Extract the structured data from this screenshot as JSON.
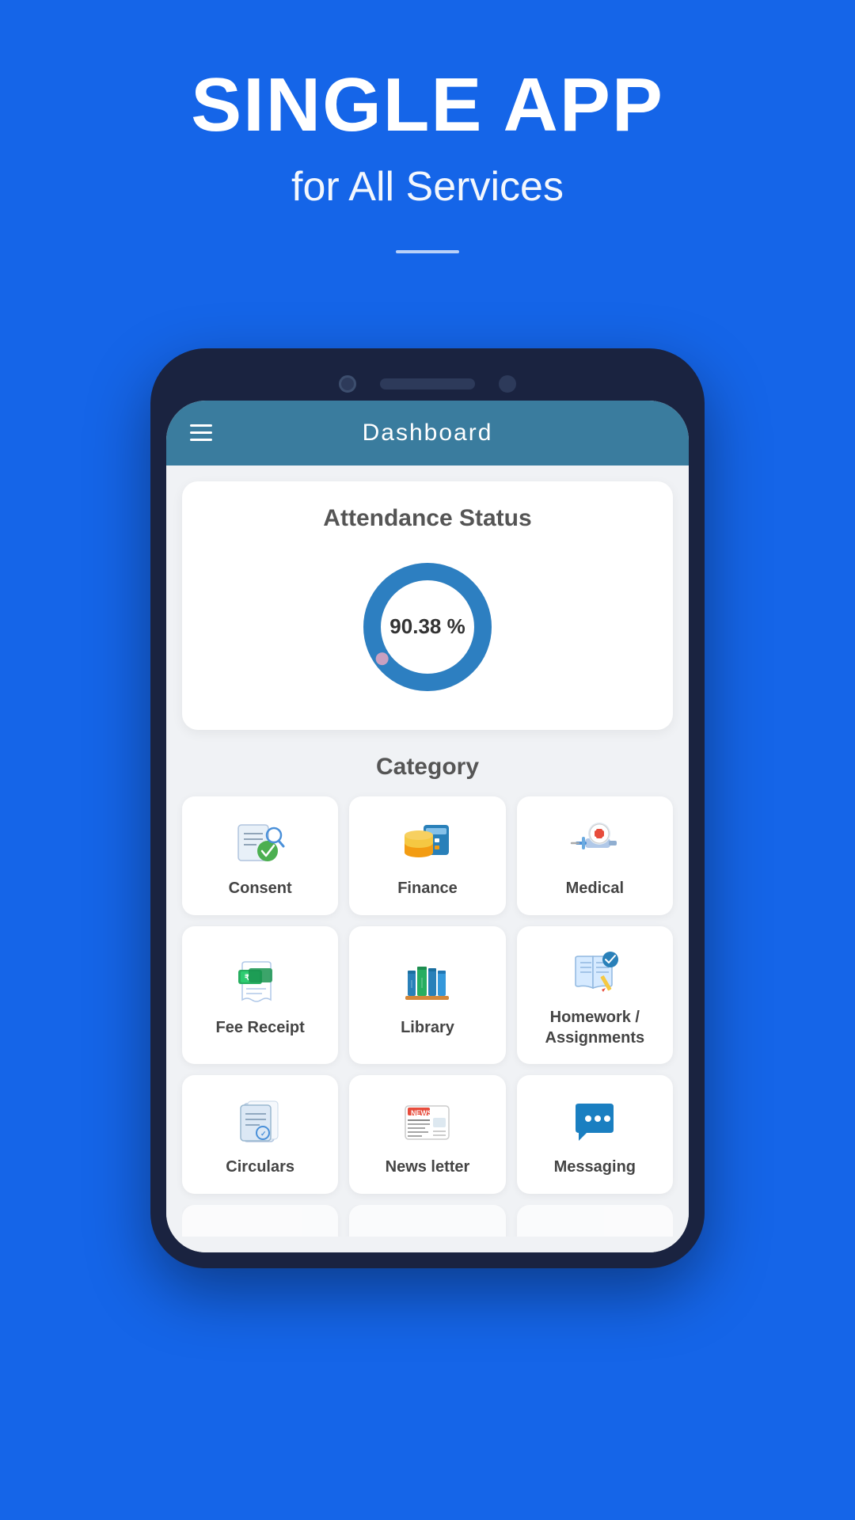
{
  "hero": {
    "title": "SINGLE APP",
    "subtitle": "for All Services"
  },
  "dashboard": {
    "header_title": "Dashboard",
    "hamburger_label": "Menu"
  },
  "attendance": {
    "section_title": "Attendance Status",
    "percentage": "90.38 %",
    "donut_value": 90.38,
    "donut_color": "#2d7fc1",
    "track_color": "#e8e8e8"
  },
  "category": {
    "section_title": "Category",
    "items": [
      {
        "id": "consent",
        "label": "Consent",
        "icon": "consent"
      },
      {
        "id": "finance",
        "label": "Finance",
        "icon": "finance"
      },
      {
        "id": "medical",
        "label": "Medical",
        "icon": "medical"
      },
      {
        "id": "fee-receipt",
        "label": "Fee Receipt",
        "icon": "fee-receipt"
      },
      {
        "id": "library",
        "label": "Library",
        "icon": "library"
      },
      {
        "id": "homework",
        "label": "Homework /\nAssignments",
        "icon": "homework"
      },
      {
        "id": "circulars",
        "label": "Circulars",
        "icon": "circulars"
      },
      {
        "id": "newsletter",
        "label": "News letter",
        "icon": "newsletter"
      },
      {
        "id": "messaging",
        "label": "Messaging",
        "icon": "messaging"
      }
    ]
  },
  "bottom_row": {
    "visible": true
  }
}
